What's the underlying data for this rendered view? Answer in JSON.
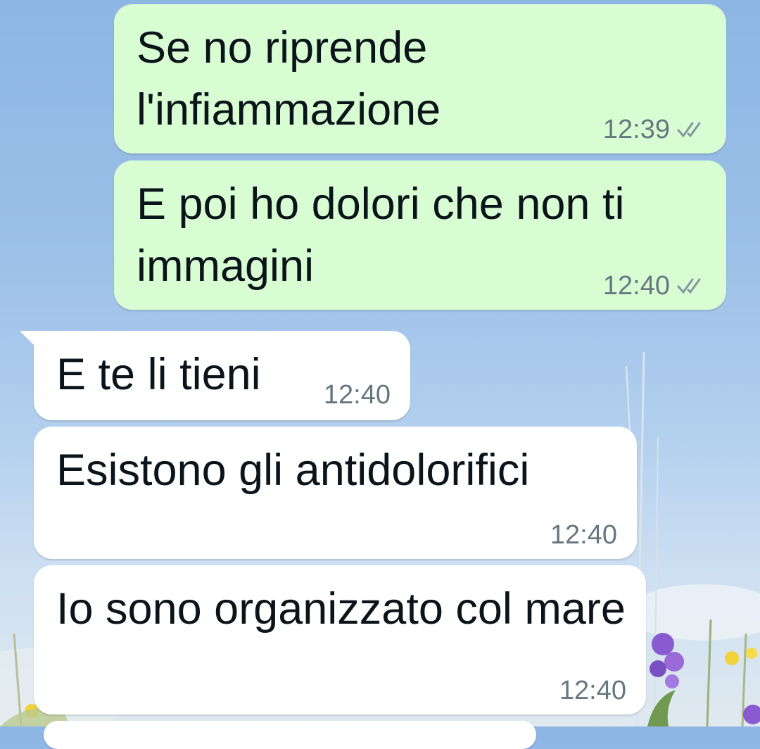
{
  "conversation": {
    "messages": [
      {
        "direction": "outgoing",
        "text": "Se no riprende l'infiammazione",
        "time": "12:39",
        "status": "double-check-icon"
      },
      {
        "direction": "outgoing",
        "text": "E poi ho dolori che non ti immagini",
        "time": "12:40",
        "status": "double-check-icon"
      },
      {
        "direction": "incoming",
        "text": "E te li tieni",
        "time": "12:40"
      },
      {
        "direction": "incoming",
        "text": "Esistono gli antidolorifici",
        "time": "12:40"
      },
      {
        "direction": "incoming",
        "text": "Io sono organizzato col mare",
        "time": "12:40"
      }
    ]
  },
  "colors": {
    "outgoing_bubble": "#d9fdd3",
    "incoming_bubble": "#ffffff",
    "text": "#0b141a",
    "meta_text": "#667781"
  }
}
